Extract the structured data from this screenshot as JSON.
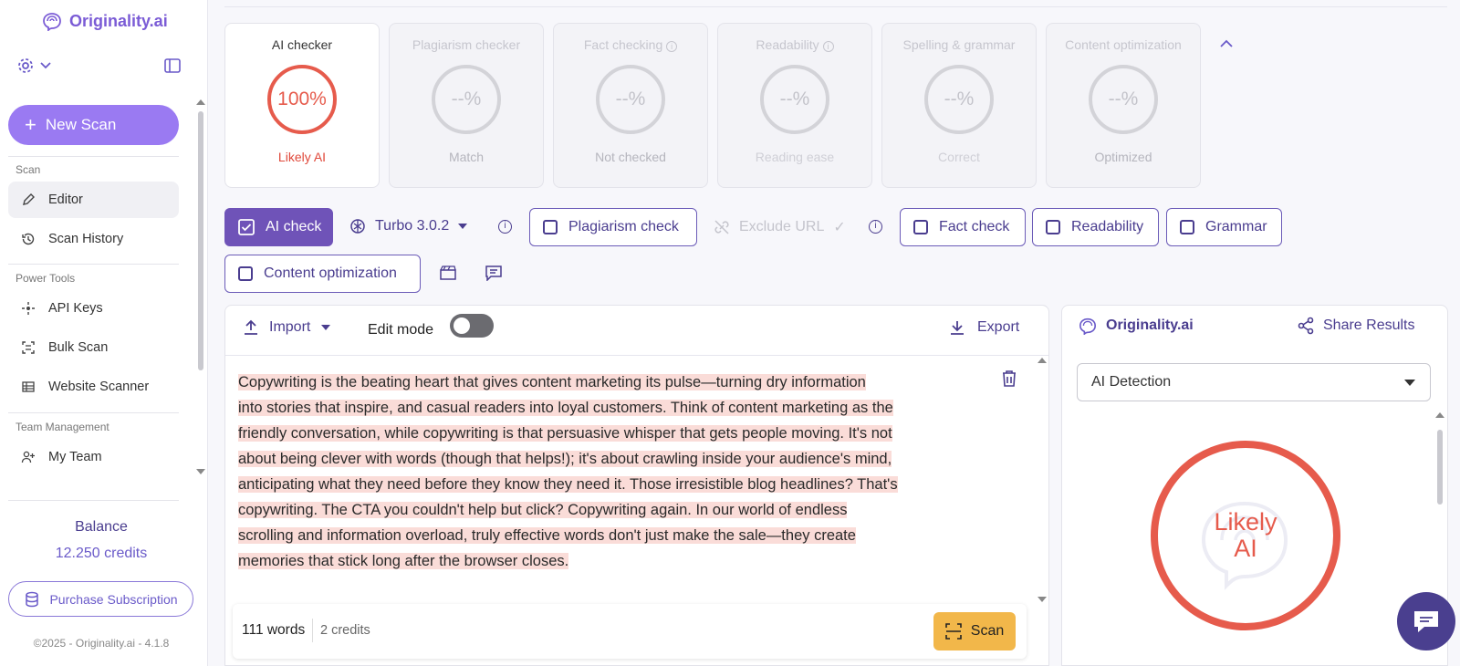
{
  "sidebar": {
    "brand": "Originality.ai",
    "new_scan": "New Scan",
    "sections": {
      "scan": "Scan",
      "power_tools": "Power Tools",
      "team": "Team Management"
    },
    "items": {
      "editor": "Editor",
      "history": "Scan History",
      "api": "API Keys",
      "bulk": "Bulk Scan",
      "website": "Website Scanner",
      "team": "My Team"
    },
    "balance_label": "Balance",
    "balance_value": "12.250 credits",
    "purchase": "Purchase Subscription",
    "copyright": "©2025 - Originality.ai - 4.1.8"
  },
  "cards": [
    {
      "title": "AI checker",
      "value": "100%",
      "sub": "Likely AI"
    },
    {
      "title": "Plagiarism checker",
      "value": "--%",
      "sub": "Match"
    },
    {
      "title": "Fact checking",
      "value": "--%",
      "sub": "Not checked"
    },
    {
      "title": "Readability",
      "value": "--%",
      "sub": "Reading ease"
    },
    {
      "title": "Spelling & grammar",
      "value": "--%",
      "sub": "Correct"
    },
    {
      "title": "Content optimization",
      "value": "--%",
      "sub": "Optimized"
    }
  ],
  "toolbar": {
    "ai_check": "AI check",
    "model": "Turbo 3.0.2",
    "plagiarism": "Plagiarism check",
    "exclude_url": "Exclude URL",
    "fact": "Fact check",
    "readability": "Readability",
    "grammar": "Grammar",
    "content_opt": "Content optimization"
  },
  "editor": {
    "import": "Import",
    "edit_mode": "Edit mode",
    "export": "Export",
    "lines": [
      "Copywriting is the beating heart that gives content marketing its pulse—turning dry information",
      "into stories that inspire, and casual readers into loyal customers. Think of content marketing as the",
      "friendly conversation, while copywriting is that persuasive whisper that gets people moving. It's not",
      "about being clever with words (though that helps!); it's about crawling inside your audience's mind,",
      "anticipating what they need before they know they need it. Those irresistible blog headlines? That's",
      "copywriting. The CTA you couldn't help but click? Copywriting again. In our world of endless",
      "scrolling and information overload, truly effective words don't just make the sale—they create",
      "memories that stick long after the browser closes."
    ],
    "words": "111 words",
    "credits": "2 credits",
    "scan": "Scan"
  },
  "results": {
    "brand": "Originality.ai",
    "share": "Share Results",
    "mode": "AI Detection",
    "verdict_line1": "Likely",
    "verdict_line2": "AI"
  },
  "colors": {
    "accent": "#9a7af2",
    "ai_red": "#e65b4c",
    "scan_yellow": "#f2b74a",
    "primary_btn": "#6f53b8"
  }
}
